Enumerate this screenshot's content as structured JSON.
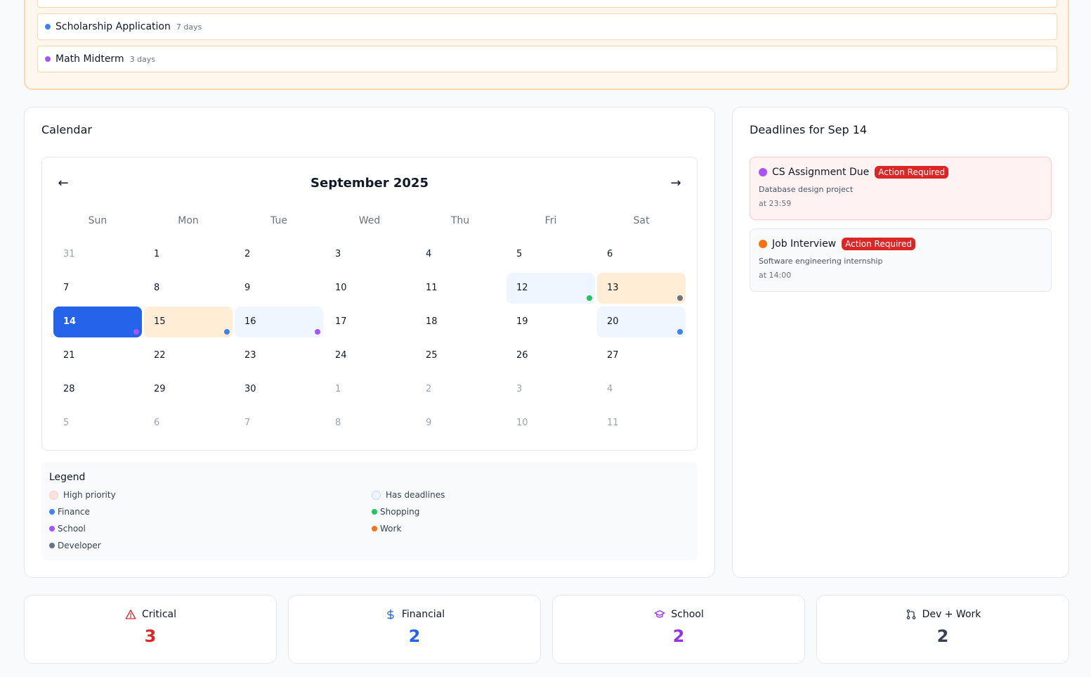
{
  "upcoming": {
    "items": [
      {
        "title": "Scholarship Application",
        "days": "7 days",
        "color": "#3b82f6"
      },
      {
        "title": "Math Midterm",
        "days": "3 days",
        "color": "#a855f7"
      }
    ]
  },
  "calendar": {
    "title": "Calendar",
    "month_label": "September 2025",
    "prev_label": "←",
    "next_label": "→",
    "weekdays": [
      "Sun",
      "Mon",
      "Tue",
      "Wed",
      "Thu",
      "Fri",
      "Sat"
    ],
    "weeks": [
      [
        {
          "d": "31",
          "other": true
        },
        {
          "d": "1"
        },
        {
          "d": "2"
        },
        {
          "d": "3"
        },
        {
          "d": "4"
        },
        {
          "d": "5"
        },
        {
          "d": "6"
        }
      ],
      [
        {
          "d": "7"
        },
        {
          "d": "8"
        },
        {
          "d": "9"
        },
        {
          "d": "10"
        },
        {
          "d": "11"
        },
        {
          "d": "12",
          "state": "deadline",
          "dot": "#22c55e"
        },
        {
          "d": "13",
          "state": "high",
          "dot": "#6b7280"
        }
      ],
      [
        {
          "d": "14",
          "state": "selected",
          "dot": "#a855f7"
        },
        {
          "d": "15",
          "state": "high",
          "dot": "#3b82f6"
        },
        {
          "d": "16",
          "state": "deadline",
          "dot": "#a855f7"
        },
        {
          "d": "17"
        },
        {
          "d": "18"
        },
        {
          "d": "19"
        },
        {
          "d": "20",
          "state": "deadline",
          "dot": "#3b82f6"
        }
      ],
      [
        {
          "d": "21"
        },
        {
          "d": "22"
        },
        {
          "d": "23"
        },
        {
          "d": "24"
        },
        {
          "d": "25"
        },
        {
          "d": "26"
        },
        {
          "d": "27"
        }
      ],
      [
        {
          "d": "28"
        },
        {
          "d": "29"
        },
        {
          "d": "30"
        },
        {
          "d": "1",
          "other": true
        },
        {
          "d": "2",
          "other": true
        },
        {
          "d": "3",
          "other": true
        },
        {
          "d": "4",
          "other": true
        }
      ],
      [
        {
          "d": "5",
          "other": true
        },
        {
          "d": "6",
          "other": true
        },
        {
          "d": "7",
          "other": true
        },
        {
          "d": "8",
          "other": true
        },
        {
          "d": "9",
          "other": true
        },
        {
          "d": "10",
          "other": true
        },
        {
          "d": "11",
          "other": true
        }
      ]
    ]
  },
  "legend": {
    "title": "Legend",
    "items": [
      {
        "label": "High priority",
        "kind": "swatch",
        "color": "#fee2e2",
        "border": "#fecaca"
      },
      {
        "label": "Has deadlines",
        "kind": "swatch",
        "color": "#eff6ff",
        "border": "#bfdbfe"
      },
      {
        "label": "Finance",
        "kind": "dot",
        "color": "#3b82f6"
      },
      {
        "label": "Shopping",
        "kind": "dot",
        "color": "#22c55e"
      },
      {
        "label": "School",
        "kind": "dot",
        "color": "#a855f7"
      },
      {
        "label": "Work",
        "kind": "dot",
        "color": "#f97316"
      },
      {
        "label": "Developer",
        "kind": "dot",
        "color": "#6b7280"
      }
    ]
  },
  "deadlines": {
    "title": "Deadlines for Sep 14",
    "items": [
      {
        "title": "CS Assignment Due",
        "badge": "Action Required",
        "desc": "Database design project",
        "time": "at 23:59",
        "dot": "#a855f7",
        "bg": "#fef2f2",
        "border": "#fecaca"
      },
      {
        "title": "Job Interview",
        "badge": "Action Required",
        "desc": "Software engineering internship",
        "time": "at 14:00",
        "dot": "#f97316",
        "bg": "#f9fafb",
        "border": "#e5e7eb"
      }
    ]
  },
  "stats": [
    {
      "label": "Critical",
      "value": "3",
      "icon": "warning-triangle-icon",
      "color": "#dc2626"
    },
    {
      "label": "Financial",
      "value": "2",
      "icon": "dollar-icon",
      "color": "#2563eb"
    },
    {
      "label": "School",
      "value": "2",
      "icon": "graduation-cap-icon",
      "color": "#9333ea"
    },
    {
      "label": "Dev + Work",
      "value": "2",
      "icon": "git-pull-request-icon",
      "color": "#374151"
    }
  ]
}
